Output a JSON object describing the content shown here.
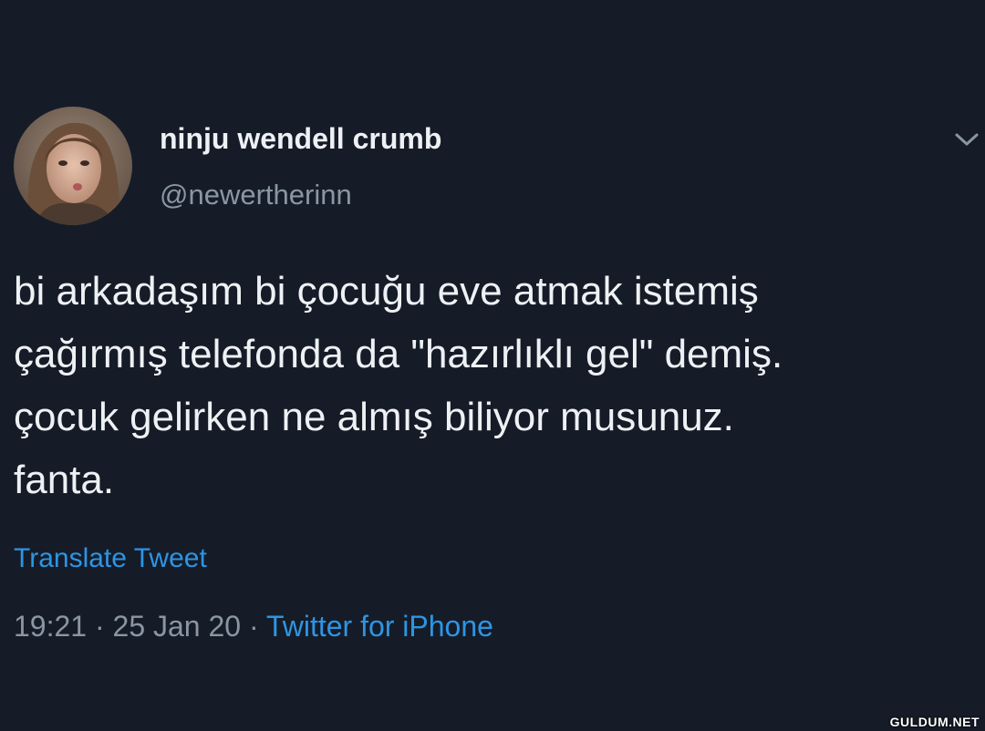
{
  "tweet": {
    "display_name": "ninju wendell crumb",
    "handle": "@newertherinn",
    "text_lines": [
      "bi arkadaşım bi çocuğu eve atmak istemiş",
      "çağırmış telefonda da \"hazırlıklı gel\" demiş.",
      "çocuk gelirken ne almış biliyor musunuz.",
      "fanta."
    ],
    "translate_label": "Translate Tweet",
    "time": "19:21",
    "date": "25 Jan 20",
    "separator": "·",
    "source": "Twitter for iPhone",
    "more_icon": "chevron-down-icon"
  },
  "watermark": "GULDUM.NET",
  "colors": {
    "background": "#151c28",
    "primary_text": "#eef1f4",
    "secondary_text": "#8a96a3",
    "link": "#2d95e4"
  }
}
